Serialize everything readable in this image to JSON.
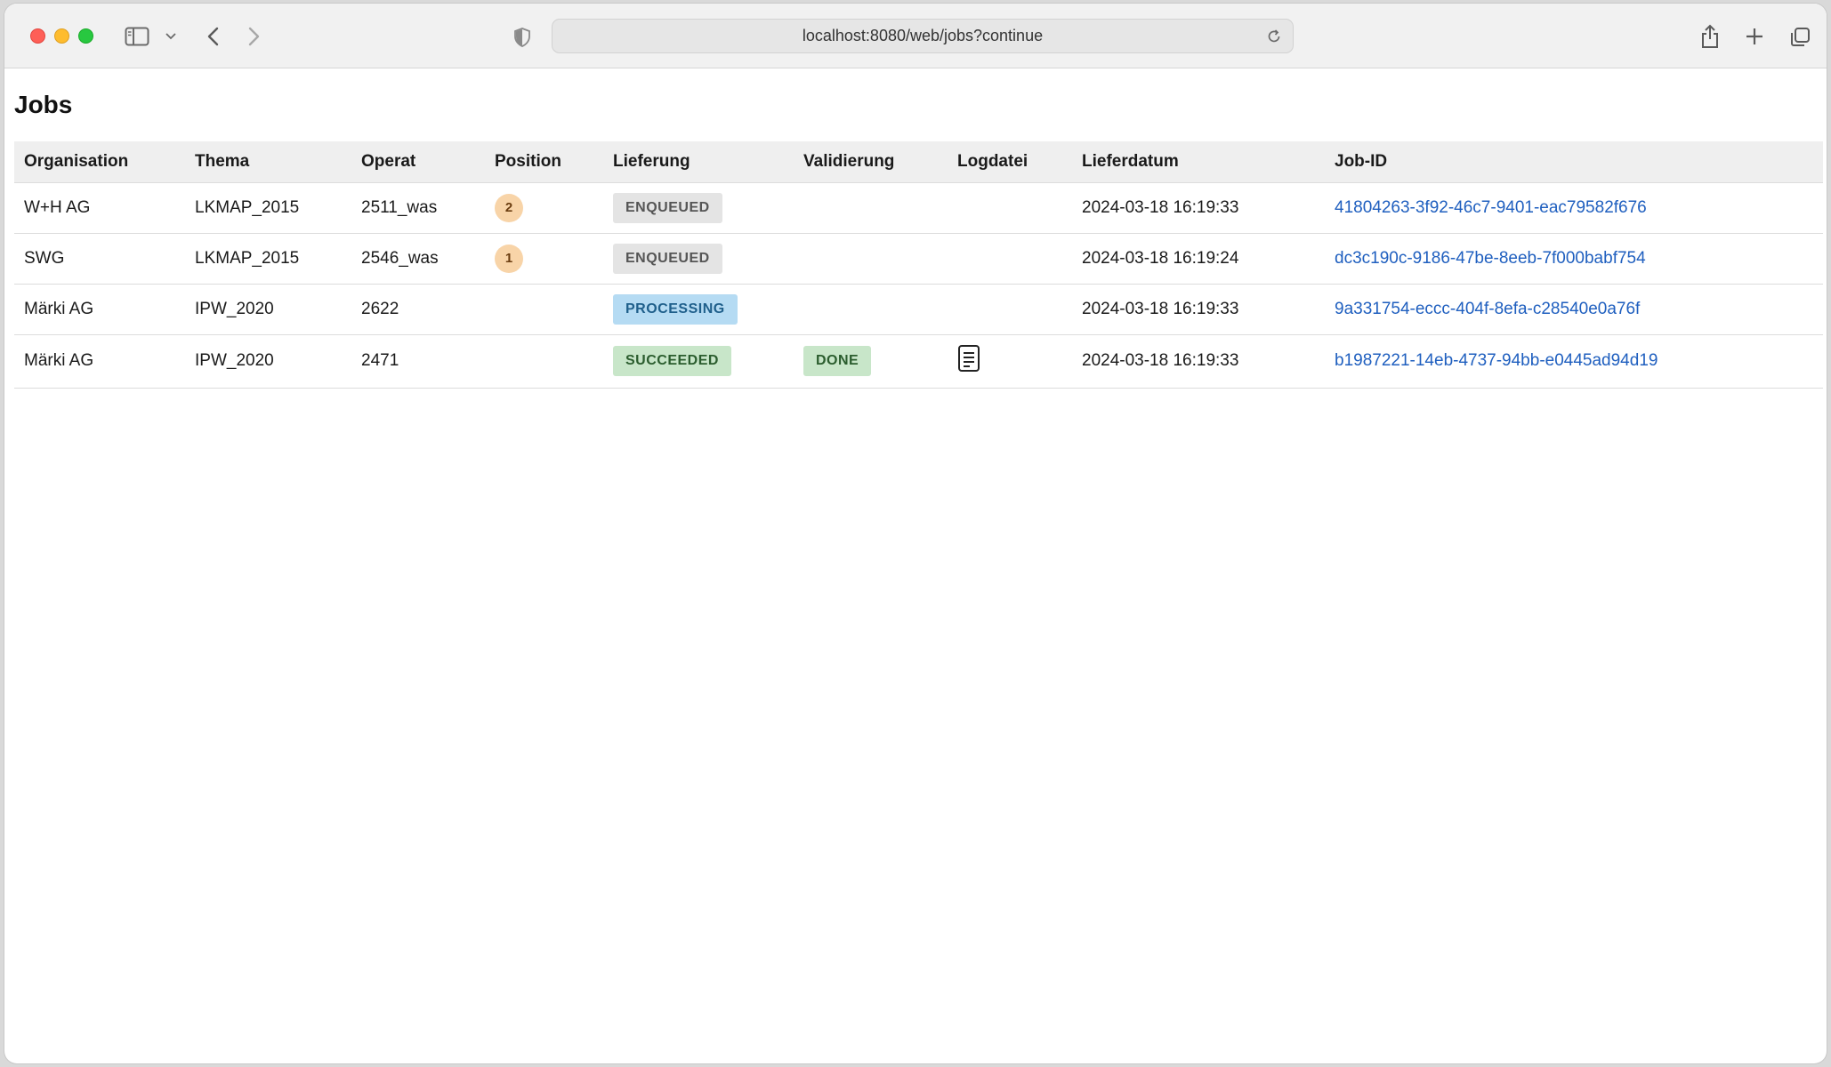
{
  "browser": {
    "url": "localhost:8080/web/jobs?continue"
  },
  "page": {
    "title": "Jobs"
  },
  "table": {
    "headers": [
      "Organisation",
      "Thema",
      "Operat",
      "Position",
      "Lieferung",
      "Validierung",
      "Logdatei",
      "Lieferdatum",
      "Job-ID"
    ],
    "rows": [
      {
        "organisation": "W+H AG",
        "thema": "LKMAP_2015",
        "operat": "2511_was",
        "position": "2",
        "lieferung": "ENQUEUED",
        "validierung": "",
        "logdatei": "",
        "lieferdatum": "2024-03-18 16:19:33",
        "job_id": "41804263-3f92-46c7-9401-eac79582f676"
      },
      {
        "organisation": "SWG",
        "thema": "LKMAP_2015",
        "operat": "2546_was",
        "position": "1",
        "lieferung": "ENQUEUED",
        "validierung": "",
        "logdatei": "",
        "lieferdatum": "2024-03-18 16:19:24",
        "job_id": "dc3c190c-9186-47be-8eeb-7f000babf754"
      },
      {
        "organisation": "Märki AG",
        "thema": "IPW_2020",
        "operat": "2622",
        "position": "",
        "lieferung": "PROCESSING",
        "validierung": "",
        "logdatei": "",
        "lieferdatum": "2024-03-18 16:19:33",
        "job_id": "9a331754-eccc-404f-8efa-c28540e0a76f"
      },
      {
        "organisation": "Märki AG",
        "thema": "IPW_2020",
        "operat": "2471",
        "position": "",
        "lieferung": "SUCCEEDED",
        "validierung": "DONE",
        "logdatei": "document-icon",
        "lieferdatum": "2024-03-18 16:19:33",
        "job_id": "b1987221-14eb-4737-94bb-e0445ad94d19"
      }
    ]
  },
  "colors": {
    "link": "#1f5fbf",
    "enqueued_bg": "#e4e4e4",
    "processing_bg": "#b5dbf3",
    "succeeded_bg": "#c8e6c9",
    "position_badge_bg": "#f8d4a8"
  }
}
